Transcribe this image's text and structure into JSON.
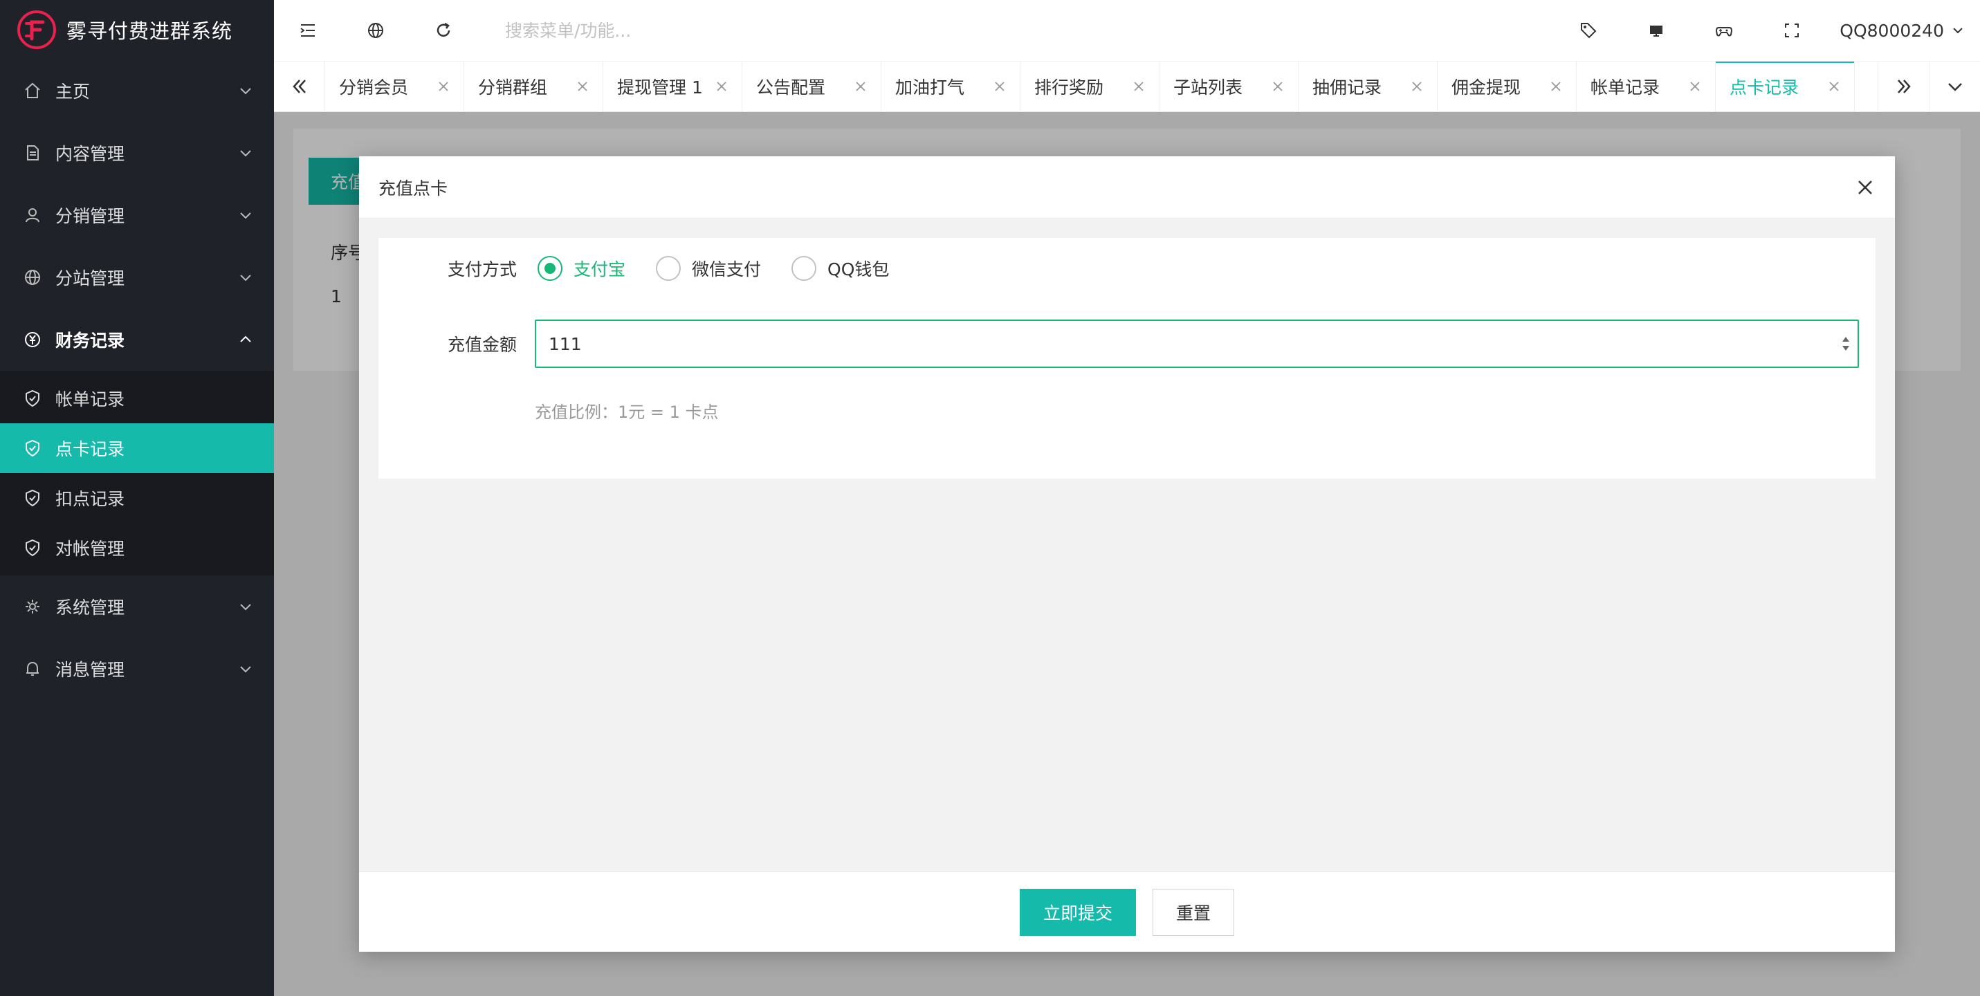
{
  "app": {
    "title": "雾寻付费进群系统",
    "accent": "#16baaa",
    "sidebar_bg": "#20222a"
  },
  "header": {
    "search_placeholder": "搜索菜单/功能...",
    "username": "QQ8000240"
  },
  "sidebar": {
    "items": [
      {
        "label": "主页",
        "icon": "home-icon"
      },
      {
        "label": "内容管理",
        "icon": "document-icon"
      },
      {
        "label": "分销管理",
        "icon": "user-icon"
      },
      {
        "label": "分站管理",
        "icon": "globe-icon"
      },
      {
        "label": "财务记录",
        "icon": "yen-icon",
        "open": true
      },
      {
        "label": "系统管理",
        "icon": "gear-icon"
      },
      {
        "label": "消息管理",
        "icon": "bell-icon"
      }
    ],
    "finance_sub": [
      {
        "label": "帐单记录"
      },
      {
        "label": "点卡记录",
        "active": true
      },
      {
        "label": "扣点记录"
      },
      {
        "label": "对帐管理"
      }
    ]
  },
  "tabs": [
    {
      "label": "分销会员"
    },
    {
      "label": "分销群组"
    },
    {
      "label": "提现管理 1"
    },
    {
      "label": "公告配置"
    },
    {
      "label": "加油打气"
    },
    {
      "label": "排行奖励"
    },
    {
      "label": "子站列表"
    },
    {
      "label": "抽佣记录"
    },
    {
      "label": "佣金提现"
    },
    {
      "label": "帐单记录"
    },
    {
      "label": "点卡记录",
      "active": true
    }
  ],
  "background": {
    "button_label": "充值",
    "col_header": "序号",
    "row_value": "1"
  },
  "modal": {
    "title": "充值点卡",
    "payment_label": "支付方式",
    "payment_options": [
      "支付宝",
      "微信支付",
      "QQ钱包"
    ],
    "payment_selected": "支付宝",
    "amount_label": "充值金额",
    "amount_value": "111",
    "hint": "充值比例：1元 = 1 卡点",
    "submit_label": "立即提交",
    "reset_label": "重置"
  }
}
